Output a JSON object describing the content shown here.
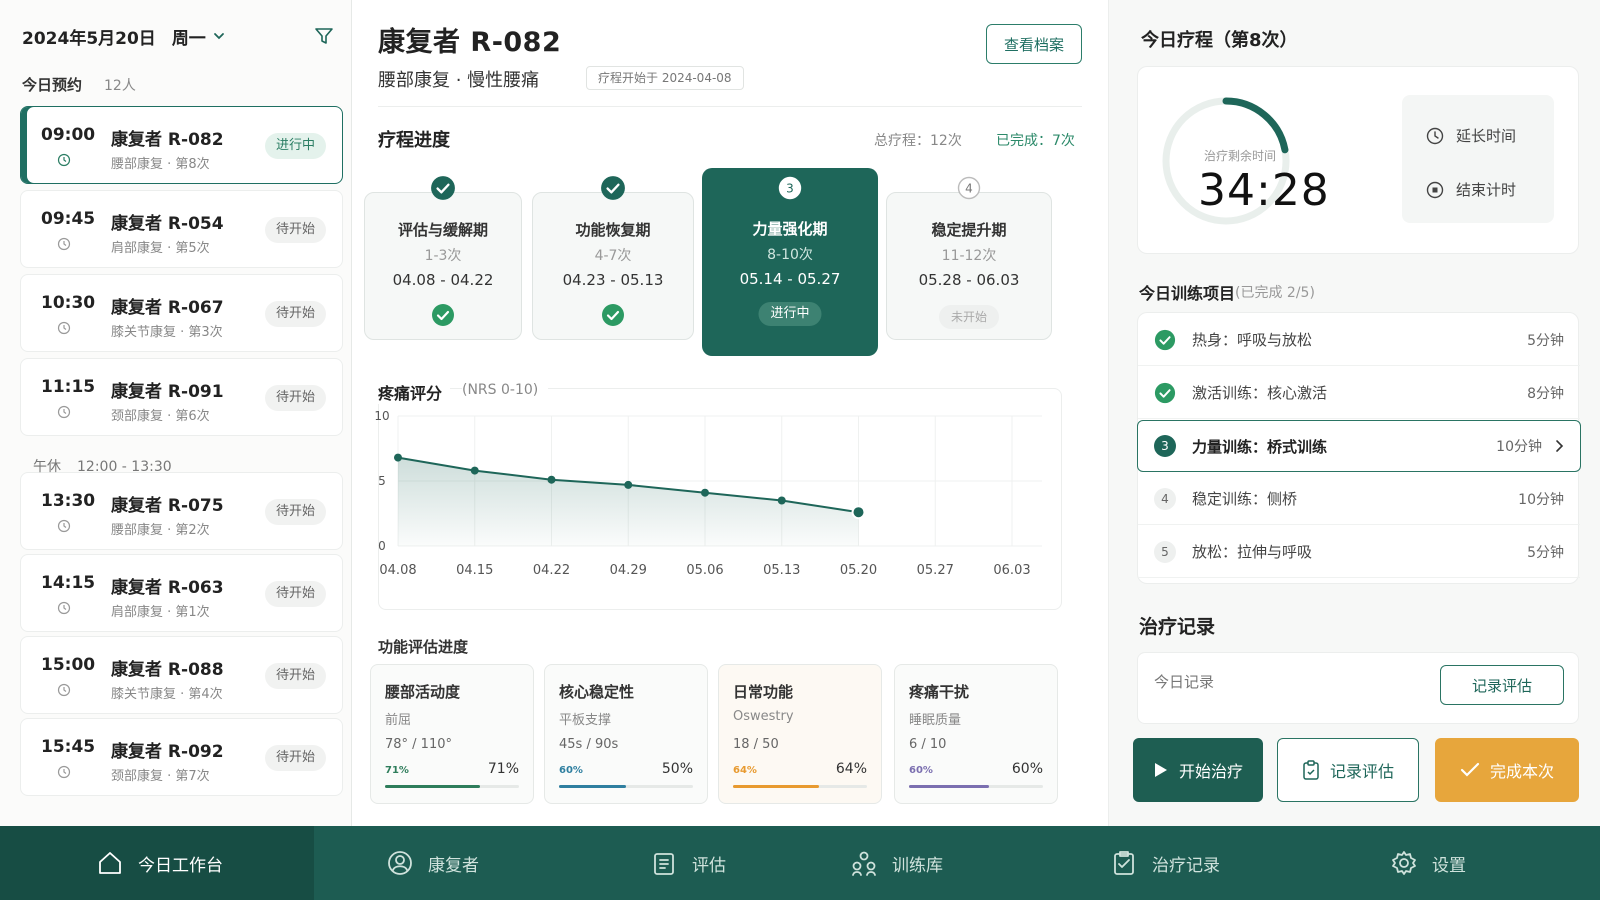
{
  "schedule": {
    "date": "2024年5月20日",
    "weekday": "周一",
    "today_title": "今日预约",
    "today_count": "12人",
    "lunch_label": "午休",
    "lunch_time": "12:00 - 13:30",
    "appointments": [
      {
        "time": "09:00",
        "name": "康复者 R-082",
        "detail": "腰部康复 · 第8次",
        "status": "进行中"
      },
      {
        "time": "09:45",
        "name": "康复者 R-054",
        "detail": "肩部康复 · 第5次",
        "status": "待开始"
      },
      {
        "time": "10:30",
        "name": "康复者 R-067",
        "detail": "膝关节康复 · 第3次",
        "status": "待开始"
      },
      {
        "time": "11:15",
        "name": "康复者 R-091",
        "detail": "颈部康复 · 第6次",
        "status": "待开始"
      },
      {
        "time": "13:30",
        "name": "康复者 R-075",
        "detail": "腰部康复 · 第2次",
        "status": "待开始"
      },
      {
        "time": "14:15",
        "name": "康复者 R-063",
        "detail": "肩部康复 · 第1次",
        "status": "待开始"
      },
      {
        "time": "15:00",
        "name": "康复者 R-088",
        "detail": "膝关节康复 · 第4次",
        "status": "待开始"
      },
      {
        "time": "15:45",
        "name": "康复者 R-092",
        "detail": "颈部康复 · 第7次",
        "status": "待开始"
      }
    ]
  },
  "patient": {
    "title": "康复者 R-082",
    "diagnosis": "腰部康复 · 慢性腰痛",
    "start": "疗程开始于 2024-04-08",
    "view_button": "查看档案"
  },
  "progress": {
    "title": "疗程进度",
    "total": "总疗程：12次",
    "done": "已完成：7次",
    "stages": [
      {
        "num": "1",
        "name": "评估与缓解期",
        "range": "1-3次",
        "dates": "04.08 - 04.22",
        "state": "done"
      },
      {
        "num": "2",
        "name": "功能恢复期",
        "range": "4-7次",
        "dates": "04.23 - 05.13",
        "state": "done"
      },
      {
        "num": "3",
        "name": "力量强化期",
        "range": "8-10次",
        "dates": "05.14 - 05.27",
        "state": "active",
        "pill": "进行中"
      },
      {
        "num": "4",
        "name": "稳定提升期",
        "range": "11-12次",
        "dates": "05.28 - 06.03",
        "state": "todo",
        "pill": "未开始"
      }
    ]
  },
  "pain": {
    "title": "疼痛评分",
    "subtitle": "(NRS 0-10)"
  },
  "chart_data": {
    "type": "line",
    "title": "疼痛评分",
    "subtitle": "(NRS 0-10)",
    "categories": [
      "04.08",
      "04.15",
      "04.22",
      "04.29",
      "05.06",
      "05.13",
      "05.20",
      "05.27",
      "06.03"
    ],
    "series": [
      {
        "values": [
          6.8,
          5.8,
          5.1,
          4.7,
          4.1,
          3.5,
          2.6
        ]
      }
    ],
    "yticks": [
      0,
      5,
      10
    ],
    "ylim": [
      0,
      10
    ],
    "grid": true,
    "color": "#1e6659"
  },
  "functional": {
    "title": "功能评估进度",
    "cards": [
      {
        "name": "腰部活动度",
        "sub": "前屈",
        "value": "78° / 110°",
        "small": "71%",
        "pct": "71%",
        "ratio": 0.71,
        "color": "#2e7d5b"
      },
      {
        "name": "核心稳定性",
        "sub": "平板支撑",
        "value": "45s / 90s",
        "small": "60%",
        "pct": "50%",
        "ratio": 0.5,
        "color": "#2f7fa0"
      },
      {
        "name": "日常功能",
        "sub": "Oswestry",
        "value": "18 / 50",
        "small": "64%",
        "pct": "64%",
        "ratio": 0.64,
        "color": "#e89a2f"
      },
      {
        "name": "疼痛干扰",
        "sub": "睡眠质量",
        "value": "6 / 10",
        "small": "60%",
        "pct": "60%",
        "ratio": 0.6,
        "color": "#7b6fb0"
      }
    ]
  },
  "session": {
    "title": "今日疗程（第8次）",
    "timer_label": "治疗剩余时间",
    "timer_value": "34:28",
    "timer_progress": 0.22,
    "extend": "延长时间",
    "stop": "结束计时"
  },
  "training": {
    "title": "今日训练项目",
    "sub": "(已完成 2/5)",
    "items": [
      {
        "num": "1",
        "name": "热身：呼吸与放松",
        "dur": "5分钟",
        "state": "done"
      },
      {
        "num": "2",
        "name": "激活训练：核心激活",
        "dur": "8分钟",
        "state": "done"
      },
      {
        "num": "3",
        "name": "力量训练：桥式训练",
        "dur": "10分钟",
        "state": "active"
      },
      {
        "num": "4",
        "name": "稳定训练：侧桥",
        "dur": "10分钟",
        "state": "todo"
      },
      {
        "num": "5",
        "name": "放松：拉伸与呼吸",
        "dur": "5分钟",
        "state": "todo"
      }
    ]
  },
  "records": {
    "title": "治疗记录",
    "today": "今日记录",
    "record_button": "记录评估"
  },
  "actions": {
    "start": "开始治疗",
    "eval": "记录评估",
    "complete": "完成本次"
  },
  "nav": {
    "items": [
      {
        "label": "今日工作台",
        "icon": "home-icon"
      },
      {
        "label": "康复者",
        "icon": "user-icon"
      },
      {
        "label": "评估",
        "icon": "clipboard-icon"
      },
      {
        "label": "训练库",
        "icon": "group-icon"
      },
      {
        "label": "治疗记录",
        "icon": "record-icon"
      },
      {
        "label": "设置",
        "icon": "gear-icon"
      }
    ]
  },
  "colors": {
    "primary": "#1e6659",
    "accent": "#e7a63c",
    "success": "#2c9a63"
  }
}
